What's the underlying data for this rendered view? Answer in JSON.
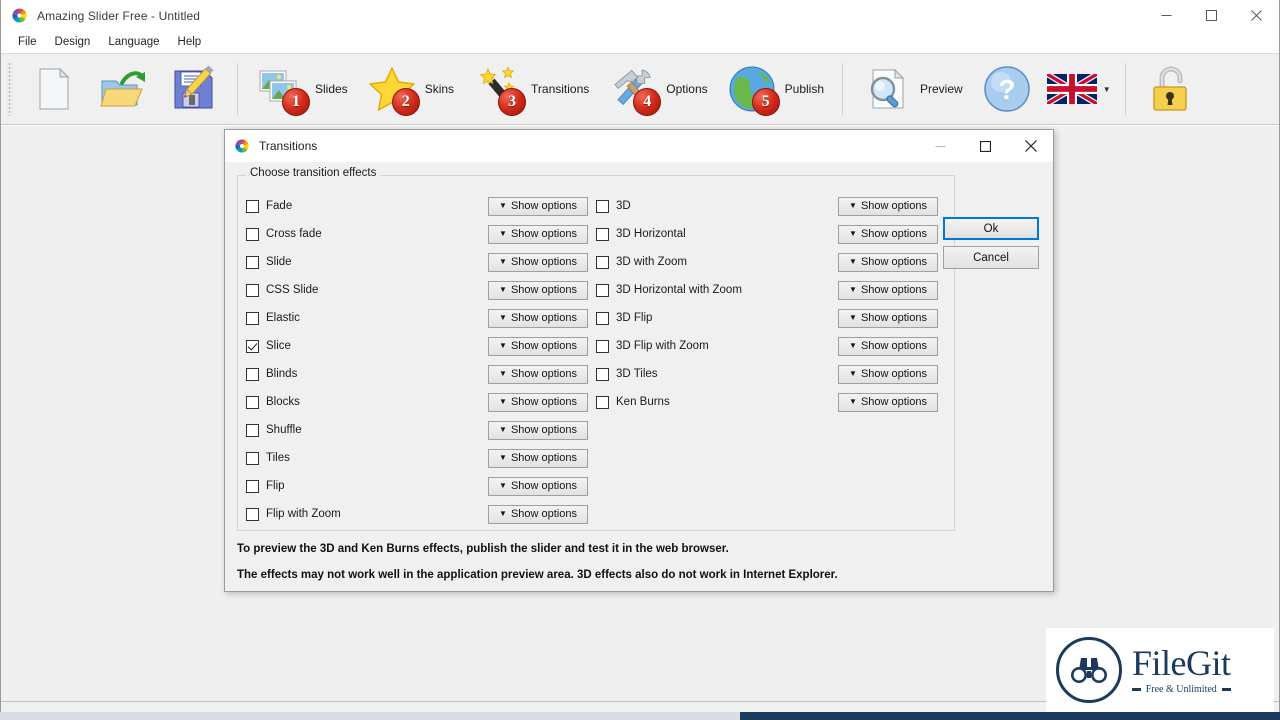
{
  "app": {
    "title": "Amazing Slider Free - Untitled",
    "icon": "pinwheel-icon",
    "window_controls": [
      {
        "name": "minimize",
        "glyph": "minimize-icon"
      },
      {
        "name": "maximize",
        "glyph": "maximize-icon"
      },
      {
        "name": "close",
        "glyph": "close-icon"
      }
    ],
    "menu": [
      {
        "label": "File"
      },
      {
        "label": "Design"
      },
      {
        "label": "Language"
      },
      {
        "label": "Help"
      }
    ],
    "toolbar": [
      {
        "name": "new",
        "label": "",
        "icon": "new-document-icon",
        "badge": ""
      },
      {
        "name": "open",
        "label": "",
        "icon": "open-folder-icon",
        "badge": ""
      },
      {
        "name": "save",
        "label": "",
        "icon": "save-disk-icon",
        "badge": ""
      },
      {
        "name": "slides",
        "label": "Slides",
        "icon": "photos-icon",
        "badge": "1"
      },
      {
        "name": "skins",
        "label": "Skins",
        "icon": "star-icon",
        "badge": "2"
      },
      {
        "name": "transitions",
        "label": "Transitions",
        "icon": "magic-wand-icon",
        "badge": "3"
      },
      {
        "name": "options",
        "label": "Options",
        "icon": "tools-icon",
        "badge": "4"
      },
      {
        "name": "publish",
        "label": "Publish",
        "icon": "globe-icon",
        "badge": "5"
      },
      {
        "name": "preview",
        "label": "Preview",
        "icon": "preview-magnifier-icon",
        "badge": ""
      },
      {
        "name": "help",
        "label": "",
        "icon": "question-mark-icon",
        "badge": ""
      },
      {
        "name": "language",
        "label": "",
        "icon": "uk-flag-icon",
        "badge": ""
      },
      {
        "name": "unlock",
        "label": "",
        "icon": "padlock-icon",
        "badge": ""
      }
    ]
  },
  "dialog": {
    "title": "Transitions",
    "icon": "pinwheel-icon",
    "group_legend": "Choose transition effects",
    "show_options_label": "Show options",
    "caret": "▼",
    "effects_left": [
      {
        "label": "Fade",
        "checked": false
      },
      {
        "label": "Cross fade",
        "checked": false
      },
      {
        "label": "Slide",
        "checked": false
      },
      {
        "label": "CSS Slide",
        "checked": false
      },
      {
        "label": "Elastic",
        "checked": false
      },
      {
        "label": "Slice",
        "checked": true
      },
      {
        "label": "Blinds",
        "checked": false
      },
      {
        "label": "Blocks",
        "checked": false
      },
      {
        "label": "Shuffle",
        "checked": false
      },
      {
        "label": "Tiles",
        "checked": false
      },
      {
        "label": "Flip",
        "checked": false
      },
      {
        "label": "Flip with Zoom",
        "checked": false
      }
    ],
    "effects_right": [
      {
        "label": "3D",
        "checked": false
      },
      {
        "label": "3D Horizontal",
        "checked": false
      },
      {
        "label": "3D with Zoom",
        "checked": false
      },
      {
        "label": "3D Horizontal with Zoom",
        "checked": false
      },
      {
        "label": "3D Flip",
        "checked": false
      },
      {
        "label": "3D Flip with Zoom",
        "checked": false
      },
      {
        "label": "3D Tiles",
        "checked": false
      },
      {
        "label": "Ken Burns",
        "checked": false
      }
    ],
    "ok_label": "Ok",
    "cancel_label": "Cancel",
    "footer_lines": [
      "To preview the 3D and Ken Burns effects, publish the slider and test it in the web browser.",
      "The effects may not work well in the application preview area. 3D effects also do not work in Internet Explorer."
    ],
    "window_controls": [
      {
        "name": "minimize",
        "glyph": "minimize-icon"
      },
      {
        "name": "maximize",
        "glyph": "maximize-icon"
      },
      {
        "name": "close",
        "glyph": "close-icon"
      }
    ]
  },
  "watermark": {
    "name": "FileGit",
    "tagline": "Free & Unlimited",
    "icon": "binoculars-icon",
    "accent_color": "#1b3a5c"
  }
}
